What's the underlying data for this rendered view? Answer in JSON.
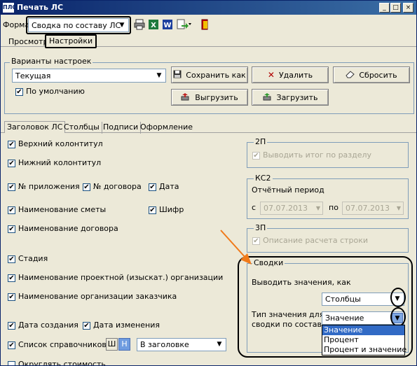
{
  "window": {
    "title": "Печать ЛС",
    "app_icon_text": "ПЛС",
    "minimize": "_",
    "maximize": "□",
    "close": "×"
  },
  "toolbar": {
    "form_label": "Форма",
    "form_value": "Сводка по составу ЛС",
    "arrow": "▼"
  },
  "main_tabs": [
    "Просмотр",
    "Настройки"
  ],
  "variants": {
    "title": "Варианты настроек",
    "value": "Текущая",
    "default_checked": "✔",
    "default_label": "По умолчанию",
    "save_as": "Сохранить как",
    "delete": "Удалить",
    "reset": "Сбросить",
    "export": "Выгрузить",
    "import": "Загрузить"
  },
  "sub_tabs": [
    "Заголовок ЛС",
    "Столбцы",
    "Подписи",
    "Оформление"
  ],
  "check": "✔",
  "left_options": {
    "top_footer": "Верхний колонтитул",
    "bottom_footer": "Нижний колонтитул",
    "appendix_no": "№ приложения",
    "contract_no": "№ договора",
    "date": "Дата",
    "estimate_name": "Наименование  сметы",
    "cipher": "Шифр",
    "contract_name": "Наименование  договора",
    "stage": "Стадия",
    "design_org": "Наименование проектной (изыскат.) организации",
    "customer_org": "Наименование организации заказчика",
    "created": "Дата создания",
    "modified": "Дата изменения",
    "ref_list": "Список справочников",
    "sh_button": "Ш",
    "n_button": "Н",
    "ref_placement": "В заголовке",
    "round_cost": "Округлять стоимость"
  },
  "group_2p": {
    "title": "2П",
    "option": "Выводить итог по разделу"
  },
  "group_ks2": {
    "title": "КС2",
    "period_label": "Отчётный период",
    "from_label": "с",
    "from_date": "07.07.2013",
    "to_label": "по",
    "to_date": "07.07.2013"
  },
  "group_3p": {
    "title": "3П",
    "option": "Описание расчета строки"
  },
  "group_svodki": {
    "title": "Сводки",
    "output_label": "Выводить значения, как",
    "output_value": "Столбцы",
    "type_label_1": "Тип значения для",
    "type_label_2": "сводки по составу",
    "type_value": "Значение",
    "dropdown_options": [
      "Значение",
      "Процент",
      "Процент и значение"
    ]
  }
}
